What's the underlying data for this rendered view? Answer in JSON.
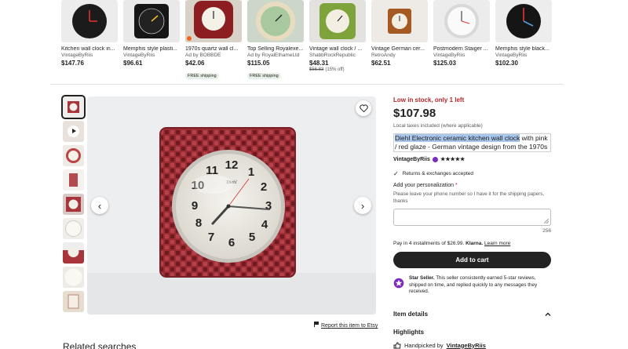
{
  "recommendations": [
    {
      "title": "Kitchen wall clock in...",
      "seller": "VintageByRiis",
      "price": "$147.76",
      "ad": "",
      "original_price": "",
      "discount": "",
      "shipping": ""
    },
    {
      "title": "Memphis style plasti...",
      "seller": "VintageByRiis",
      "price": "$96.61",
      "ad": "",
      "original_price": "",
      "discount": "",
      "shipping": ""
    },
    {
      "title": "1970s quartz wall cl...",
      "seller": "Ad by BOBBDE",
      "price": "$42.06",
      "ad": "",
      "original_price": "",
      "discount": "",
      "shipping": "FREE shipping"
    },
    {
      "title": "Top Selling Royalexe...",
      "seller": "Ad by RoyalEthameLtd",
      "price": "$115.05",
      "ad": "",
      "original_price": "",
      "discount": "",
      "shipping": "FREE shipping"
    },
    {
      "title": "Vintage wall clock / ...",
      "seller": "ShabbRockRepublic",
      "price": "$48.31",
      "ad": "",
      "original_price": "$56.83",
      "discount": "(15% off)",
      "shipping": ""
    },
    {
      "title": "Vintage German cer...",
      "seller": "RetroAndy",
      "price": "$62.51",
      "ad": "",
      "original_price": "",
      "discount": "",
      "shipping": ""
    },
    {
      "title": "Postmodern Staiger ...",
      "seller": "VintageByRiis",
      "price": "$125.03",
      "ad": "",
      "original_price": "",
      "discount": "",
      "shipping": ""
    },
    {
      "title": "Memphis style black...",
      "seller": "VintageByRiis",
      "price": "$102.30",
      "ad": "",
      "original_price": "",
      "discount": "",
      "shipping": ""
    }
  ],
  "listing": {
    "stock_text": "Low in stock, only 1 left",
    "price": "$107.98",
    "taxes": "Local taxes included (where applicable)",
    "title_selected": "Diehl Electronic ceramic kitchen wall clock",
    "title_rest": " with pink / red glaze - German vintage design from the 1970s",
    "seller": "VintageByRiis",
    "rating_stars": "★★★★★",
    "returns": "Returns & exchanges accepted",
    "personalization_label": "Add your personalization",
    "personalization_required_mark": "*",
    "personalization_hint": "Please leave your phone number so I have it for the shipping papers, thanks",
    "char_count": "256",
    "klarna_prefix": "Pay in 4 installments of $26.99.",
    "klarna_brand": "Klarna.",
    "klarna_link": "Learn more",
    "add_to_cart": "Add to cart",
    "star_seller_title": "Star Seller.",
    "star_seller_text": " This seller consistently earned 5-star reviews, shipped on time, and replied quickly to any messages they received.",
    "item_details": "Item details",
    "highlights": "Highlights",
    "handpicked_prefix": "Handpicked by ",
    "handpicked_seller": "VintageByRiis"
  },
  "gallery": {
    "report_link": "Report this item to Etsy",
    "related_heading": "Related searches",
    "clock_numbers": [
      "12",
      "1",
      "2",
      "3",
      "4",
      "5",
      "6",
      "7",
      "8",
      "9",
      "10",
      "11"
    ],
    "clock_brand": "Diehl"
  },
  "colors": {
    "stock_red": "#b3262a",
    "button_dark": "#222222",
    "selection_blue": "#a9c6ec",
    "clock_red": "#a8343c"
  }
}
